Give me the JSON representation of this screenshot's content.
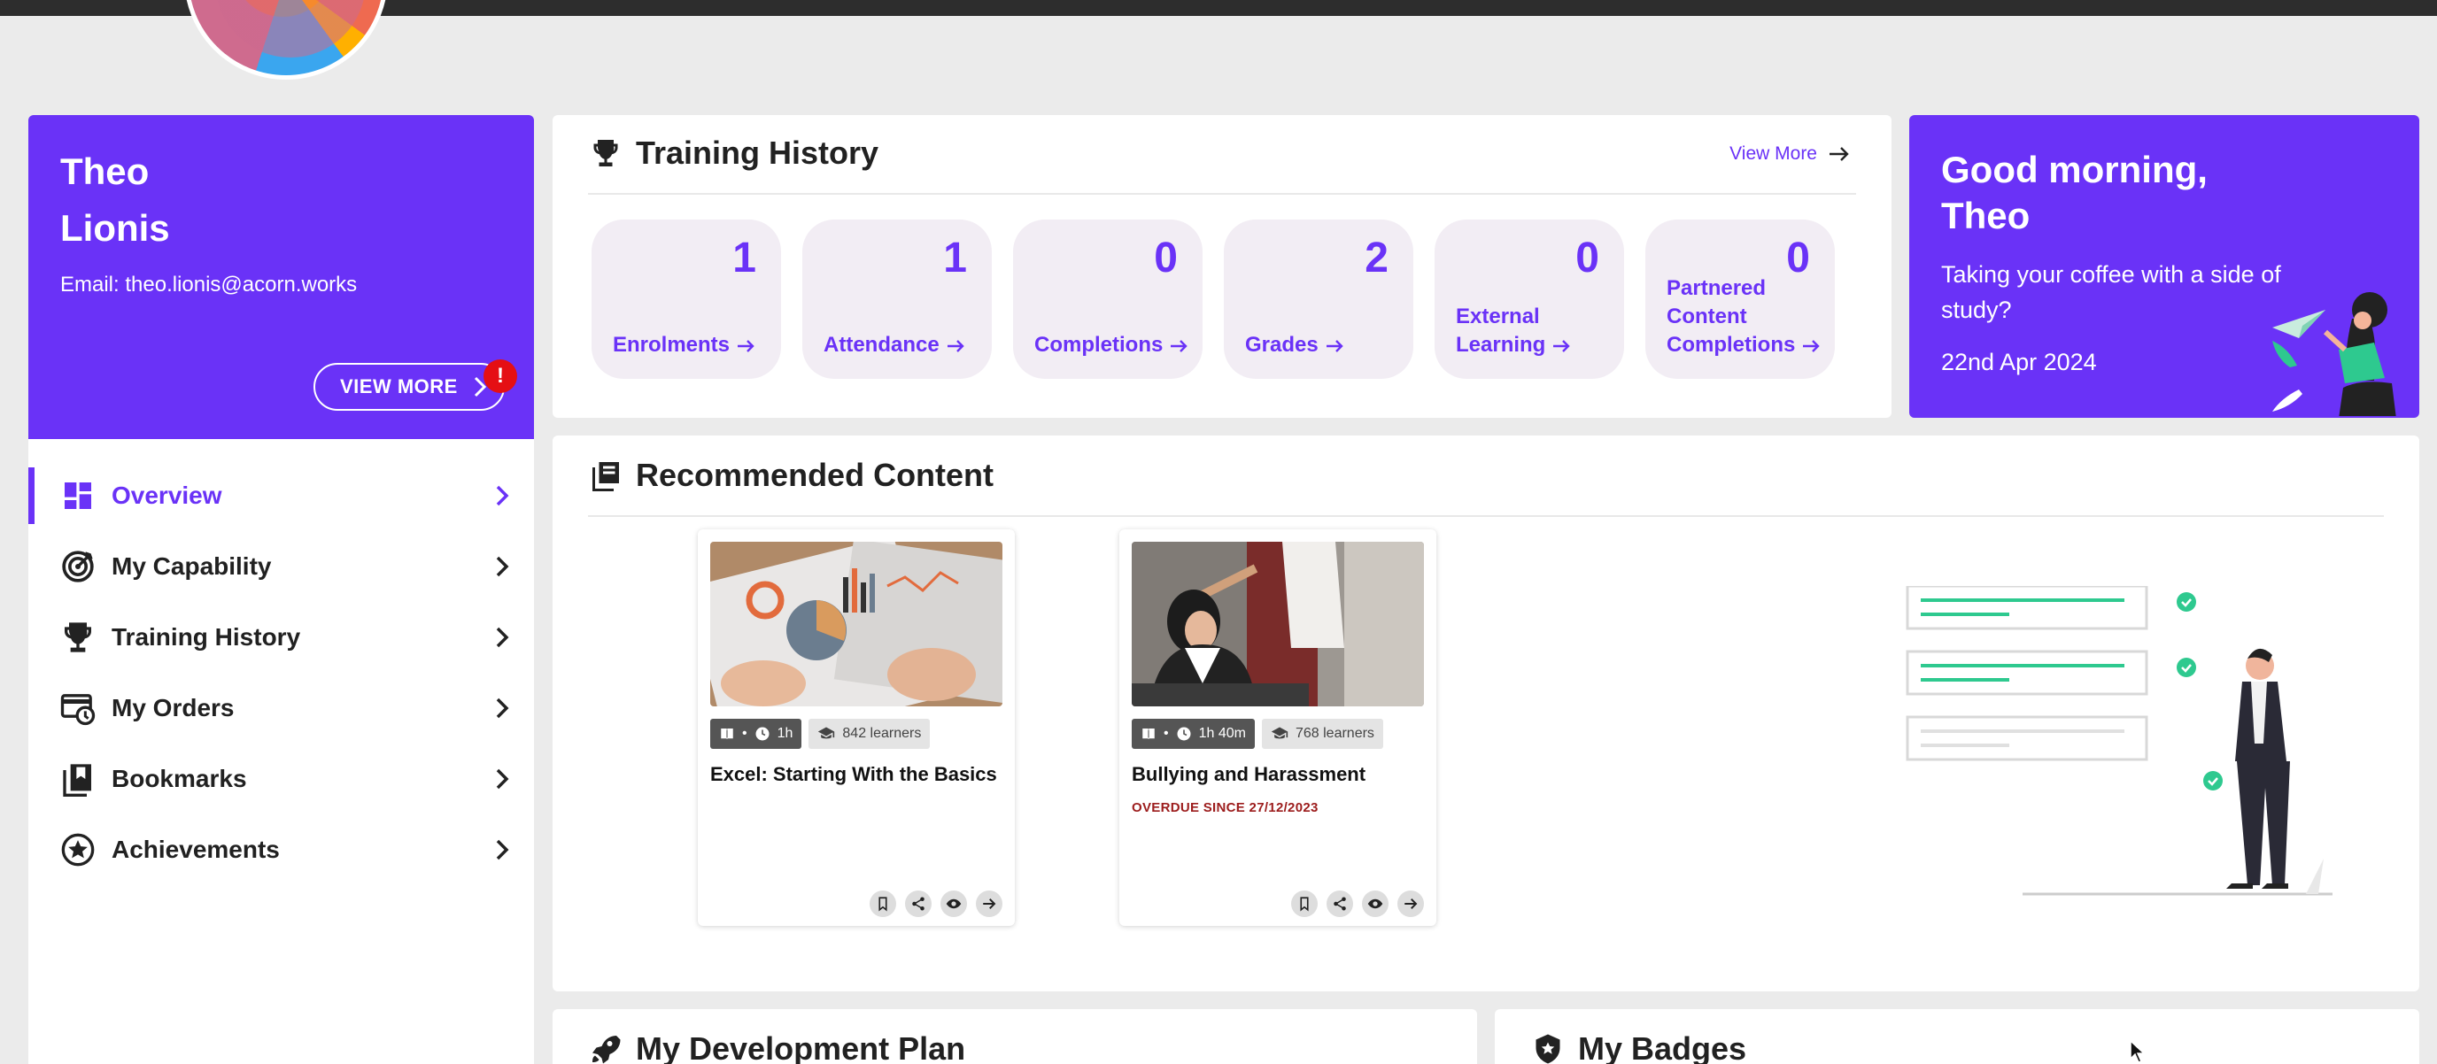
{
  "profile": {
    "first_name": "Theo",
    "last_name": "Lionis",
    "email_label": "Email:",
    "email": "theo.lionis@acorn.works",
    "view_more": "VIEW MORE",
    "alert": "!"
  },
  "nav": {
    "items": [
      {
        "label": "Overview",
        "icon": "dashboard-icon",
        "active": true
      },
      {
        "label": "My Capability",
        "icon": "target-icon"
      },
      {
        "label": "Training History",
        "icon": "trophy-icon"
      },
      {
        "label": "My Orders",
        "icon": "orders-icon"
      },
      {
        "label": "Bookmarks",
        "icon": "bookmarks-icon"
      },
      {
        "label": "Achievements",
        "icon": "star-badge-icon"
      }
    ]
  },
  "training_history": {
    "title": "Training History",
    "view_more": "View More",
    "stats": [
      {
        "value": "1",
        "label": "Enrolments"
      },
      {
        "value": "1",
        "label": "Attendance"
      },
      {
        "value": "0",
        "label": "Completions"
      },
      {
        "value": "2",
        "label": "Grades"
      },
      {
        "value": "0",
        "label_line1": "External",
        "label_line2": "Learning"
      },
      {
        "value": "0",
        "label_line1": "Partnered",
        "label_line2": "Content",
        "label_line3": "Completions"
      }
    ]
  },
  "greeting": {
    "hello": "Good morning, Theo",
    "subtitle": "Taking your coffee with a side of study?",
    "date": "22nd Apr 2024"
  },
  "recommended": {
    "title": "Recommended Content",
    "courses": [
      {
        "duration": "1h",
        "learners": "842 learners",
        "title": "Excel: Starting With the Basics",
        "overdue": ""
      },
      {
        "duration": "1h 40m",
        "learners": "768 learners",
        "title": "Bullying and Harassment",
        "overdue": "OVERDUE SINCE 27/12/2023"
      }
    ]
  },
  "development_plan": {
    "title": "My Development Plan"
  },
  "badges": {
    "title": "My Badges"
  },
  "colors": {
    "accent": "#6a32f7",
    "overdue": "#9c1c1c",
    "alert": "#e50f14",
    "success": "#2ec98f"
  }
}
